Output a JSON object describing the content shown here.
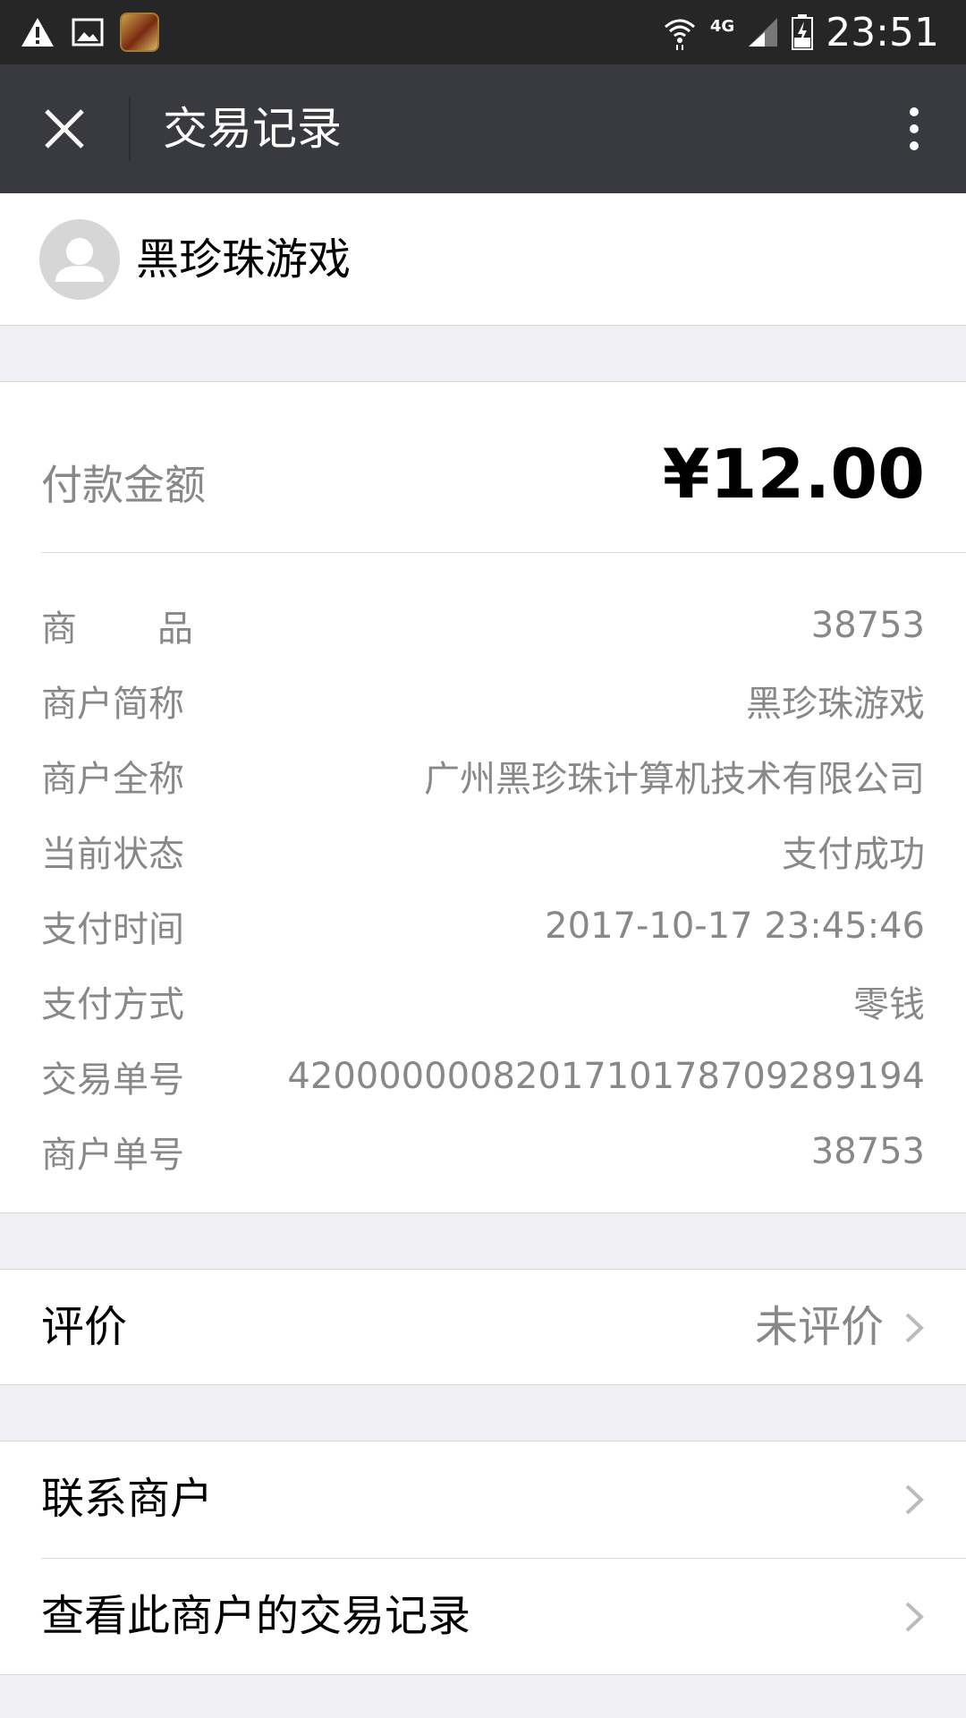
{
  "status_bar": {
    "time": "23:51",
    "network": "4G",
    "icons": [
      "warning-icon",
      "image-icon",
      "app-icon",
      "wifi-icon",
      "signal-icon",
      "battery-charging-icon"
    ]
  },
  "title_bar": {
    "title": "交易记录",
    "close_icon": "close-icon",
    "more_icon": "more-vertical-icon"
  },
  "merchant": {
    "name": "黑珍珠游戏",
    "avatar_icon": "user-avatar-icon"
  },
  "payment": {
    "amount_label": "付款金额",
    "amount": "¥12.00",
    "details": [
      {
        "label": "商品",
        "value": "38753"
      },
      {
        "label": "商户简称",
        "value": "黑珍珠游戏"
      },
      {
        "label": "商户全称",
        "value": "广州黑珍珠计算机技术有限公司"
      },
      {
        "label": "当前状态",
        "value": "支付成功"
      },
      {
        "label": "支付时间",
        "value": "2017-10-17 23:45:46"
      },
      {
        "label": "支付方式",
        "value": "零钱"
      },
      {
        "label": "交易单号",
        "value": "4200000008201710178709289194"
      },
      {
        "label": "商户单号",
        "value": "38753"
      }
    ]
  },
  "rating": {
    "label": "评价",
    "status": "未评价"
  },
  "actions": {
    "contact_merchant": "联系商户",
    "view_merchant_records": "查看此商户的交易记录"
  },
  "colors": {
    "title_bar_bg": "#393a3f",
    "status_bar_bg": "#262626",
    "page_bg": "#efeff4",
    "secondary_text": "#888888"
  }
}
